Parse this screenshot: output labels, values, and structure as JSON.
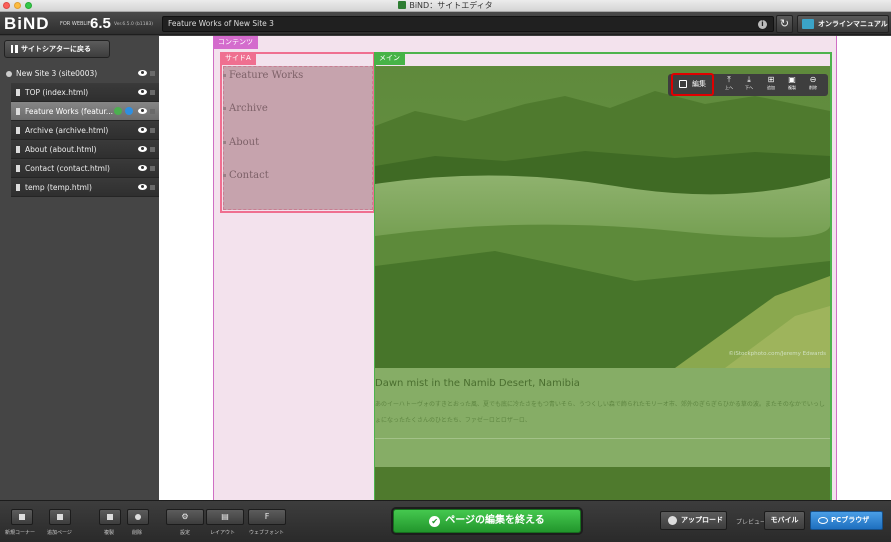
{
  "window": {
    "title": "BiND：サイトエディタ"
  },
  "header": {
    "logo": "BiND",
    "logo_sub": "FOR WEBLIFE*",
    "version": "6.5",
    "build": "Ver.6.5.0 (b1183)",
    "url": "Feature Works of New Site 3",
    "manual_label": "オンラインマニュアル"
  },
  "sidebar": {
    "back_label": "サイトシアターに戻る",
    "root": "New Site 3 (site0003)",
    "pages": [
      {
        "label": "TOP (index.html)"
      },
      {
        "label": "Feature Works (featur..."
      },
      {
        "label": "Archive (archive.html)"
      },
      {
        "label": "About (about.html)"
      },
      {
        "label": "Contact (contact.html)"
      },
      {
        "label": "temp (temp.html)"
      }
    ],
    "footer": [
      "新規コーナー",
      "追加ページ",
      "複製",
      "削除"
    ]
  },
  "canvas": {
    "content_label": "コンテンツ",
    "sideA_label": "サイドA",
    "main_label": "メイン",
    "nav": [
      "Feature Works",
      "Archive",
      "About",
      "Contact"
    ],
    "photo_credit": "©iStockphoto.com/Jeremy Edwards",
    "article_title": "Dawn mist in the Namib Desert, Namibia",
    "article_body": "あのイーハトーヴォのすきとおった風、夏でも底に冷たさをもつ青いそら、うつくしい森で飾られたモリーオ市、郊外のぎらぎらひかる草の波。またそのなかでいっしょになったたくさんのひとたち、ファゼーロとロザーロ、",
    "tools": {
      "edit": "編集",
      "up": "上へ",
      "down": "下へ",
      "add": "追加",
      "copy": "複製",
      "delete": "削除"
    }
  },
  "bottombar": {
    "settings": "設定",
    "layout": "レイアウト",
    "webfont": "ウェブフォント",
    "finish": "ページの編集を終える",
    "upload": "アップロード",
    "preview": "プレビュー",
    "mobile": "モバイル",
    "pc": "PCブラウザ"
  }
}
